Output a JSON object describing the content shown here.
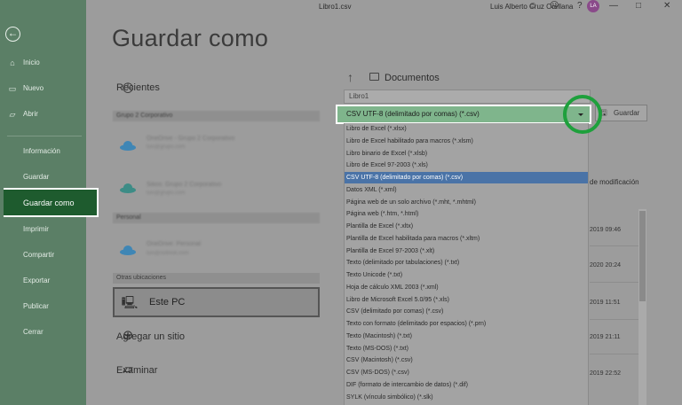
{
  "window": {
    "title": "Libro1.csv",
    "user_name": "Luis Alberto Cruz Orellana",
    "user_initials": "LA"
  },
  "sidebar": {
    "items": [
      {
        "label": "Inicio"
      },
      {
        "label": "Nuevo"
      },
      {
        "label": "Abrir"
      },
      {
        "label": "Información"
      },
      {
        "label": "Guardar"
      },
      {
        "label": "Guardar como"
      },
      {
        "label": "Imprimir"
      },
      {
        "label": "Compartir"
      },
      {
        "label": "Exportar"
      },
      {
        "label": "Publicar"
      },
      {
        "label": "Cerrar"
      }
    ],
    "active": "Guardar como"
  },
  "page_title": "Guardar como",
  "locations": {
    "recent_label": "Recientes",
    "group1_header": "Grupo 2 Corporativo",
    "onedrive1_title": "OneDrive - Grupo 2 Corporativo",
    "onedrive1_email": "luis@grupo.com",
    "sites1_title": "Sitios: Grupo 2 Corporativo",
    "sites1_email": "luis@grupo.com",
    "personal_header": "Personal",
    "onedrive2_title": "OneDrive: Personal",
    "onedrive2_email": "luis@outlook.com",
    "other_header": "Otras ubicaciones",
    "this_pc": "Este PC",
    "add_site": "Agregar un sitio",
    "browse": "Examinar"
  },
  "save_panel": {
    "folder": "Documentos",
    "filename": "Libro1",
    "selected_type": "CSV UTF-8 (delimitado por comas) (*.csv)",
    "save_button": "Guardar",
    "highlight_color": "#1ea03c"
  },
  "file_types": [
    "Libro de Excel (*.xlsx)",
    "Libro de Excel habilitado para macros (*.xlsm)",
    "Libro binario de Excel (*.xlsb)",
    "Libro de Excel 97-2003 (*.xls)",
    "CSV UTF-8 (delimitado por comas) (*.csv)",
    "Datos XML (*.xml)",
    "Página web de un solo archivo (*.mht, *.mhtml)",
    "Página web (*.htm, *.html)",
    "Plantilla de Excel (*.xltx)",
    "Plantilla de Excel habilitada para macros (*.xltm)",
    "Plantilla de Excel 97-2003 (*.xlt)",
    "Texto (delimitado por tabulaciones) (*.txt)",
    "Texto Unicode (*.txt)",
    "Hoja de cálculo XML 2003 (*.xml)",
    "Libro de Microsoft Excel 5.0/95 (*.xls)",
    "CSV (delimitado por comas) (*.csv)",
    "Texto con formato (delimitado por espacios) (*.prn)",
    "Texto (Macintosh) (*.txt)",
    "Texto (MS-DOS) (*.txt)",
    "CSV (Macintosh) (*.csv)",
    "CSV (MS-DOS) (*.csv)",
    "DIF (formato de intercambio de datos) (*.dif)",
    "SYLK (vínculo simbólico) (*.slk)"
  ],
  "selected_index": 4,
  "file_list": {
    "column_header": "de modificación",
    "dates": [
      "2019 09:46",
      "2020 20:24",
      "2019 11:51",
      "2019 21:11",
      "2019 22:52"
    ]
  }
}
